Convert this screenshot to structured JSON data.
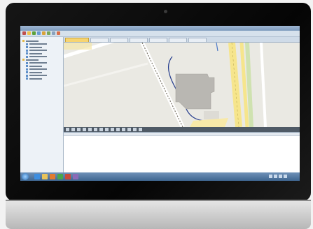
{
  "device": {
    "colors": {
      "bezel": "#0b0b0b",
      "chin": "#cfcfcf"
    },
    "icons": [
      "webcam-icon"
    ]
  },
  "app": {
    "title": "",
    "toolbar": {
      "buttons": [
        {
          "icon": "app-logo-icon",
          "color": "#c0504d"
        },
        {
          "icon": "open-icon",
          "color": "#f0c14b"
        },
        {
          "icon": "save-icon",
          "color": "#5ca13b"
        },
        {
          "icon": "refresh-icon",
          "color": "#6a9bd1"
        },
        {
          "icon": "zoom-icon",
          "color": "#d9a23a"
        },
        {
          "icon": "settings-icon",
          "color": "#7aa85a"
        },
        {
          "icon": "print-icon",
          "color": "#8aa2bd"
        },
        {
          "icon": "help-icon",
          "color": "#d96f4b"
        }
      ]
    },
    "sidebar": {
      "items": [
        {
          "label": "",
          "icon": "folder-icon",
          "level": 0
        },
        {
          "label": "",
          "icon": "layer-icon",
          "level": 1
        },
        {
          "label": "",
          "icon": "layer-icon",
          "level": 1
        },
        {
          "label": "",
          "icon": "layer-icon",
          "level": 1
        },
        {
          "label": "",
          "icon": "layer-icon",
          "level": 1
        },
        {
          "label": "",
          "icon": "layer-icon",
          "level": 1
        },
        {
          "label": "",
          "icon": "folder-icon",
          "level": 0
        },
        {
          "label": "",
          "icon": "layer-icon",
          "level": 1
        },
        {
          "label": "",
          "icon": "layer-icon",
          "level": 1
        },
        {
          "label": "",
          "icon": "layer-icon",
          "level": 1
        },
        {
          "label": "",
          "icon": "layer-icon",
          "level": 1
        },
        {
          "label": "",
          "icon": "layer-icon",
          "level": 1
        },
        {
          "label": "",
          "icon": "layer-icon",
          "level": 1
        }
      ]
    },
    "tabs": [
      {
        "label": "",
        "active": true
      },
      {
        "label": "",
        "active": false
      },
      {
        "label": "",
        "active": false
      },
      {
        "label": "",
        "active": false
      },
      {
        "label": "",
        "active": false
      },
      {
        "label": "",
        "active": false
      },
      {
        "label": "",
        "active": false
      }
    ],
    "map": {
      "labels": [
        "",
        "",
        "",
        ""
      ],
      "colors": {
        "background": "#eae9e3",
        "building": "#b9b7b2",
        "road": "#ffffff",
        "major_road": "#f6e58c",
        "track": "#7a7466",
        "trail": "#223a8c"
      }
    },
    "map_toolbar": {
      "buttons": [
        "pan-icon",
        "zoom-in-icon",
        "zoom-out-icon",
        "select-icon",
        "measure-icon",
        "draw-line-icon",
        "draw-polygon-icon",
        "edit-icon",
        "delete-icon",
        "layers-icon",
        "identify-icon",
        "export-icon",
        "print-icon",
        "fullscreen-icon"
      ]
    },
    "grid": {
      "headers": [],
      "rows": []
    }
  },
  "taskbar": {
    "items": [
      {
        "icon": "ie-icon",
        "color": "#3d8ee0"
      },
      {
        "icon": "folder-icon",
        "color": "#e8c35a"
      },
      {
        "icon": "media-icon",
        "color": "#e07b2f"
      },
      {
        "icon": "browser-icon",
        "color": "#49a64c"
      },
      {
        "icon": "app-icon",
        "color": "#c94b3b"
      },
      {
        "icon": "app-icon",
        "color": "#8b6bb7"
      }
    ],
    "clock": ""
  }
}
